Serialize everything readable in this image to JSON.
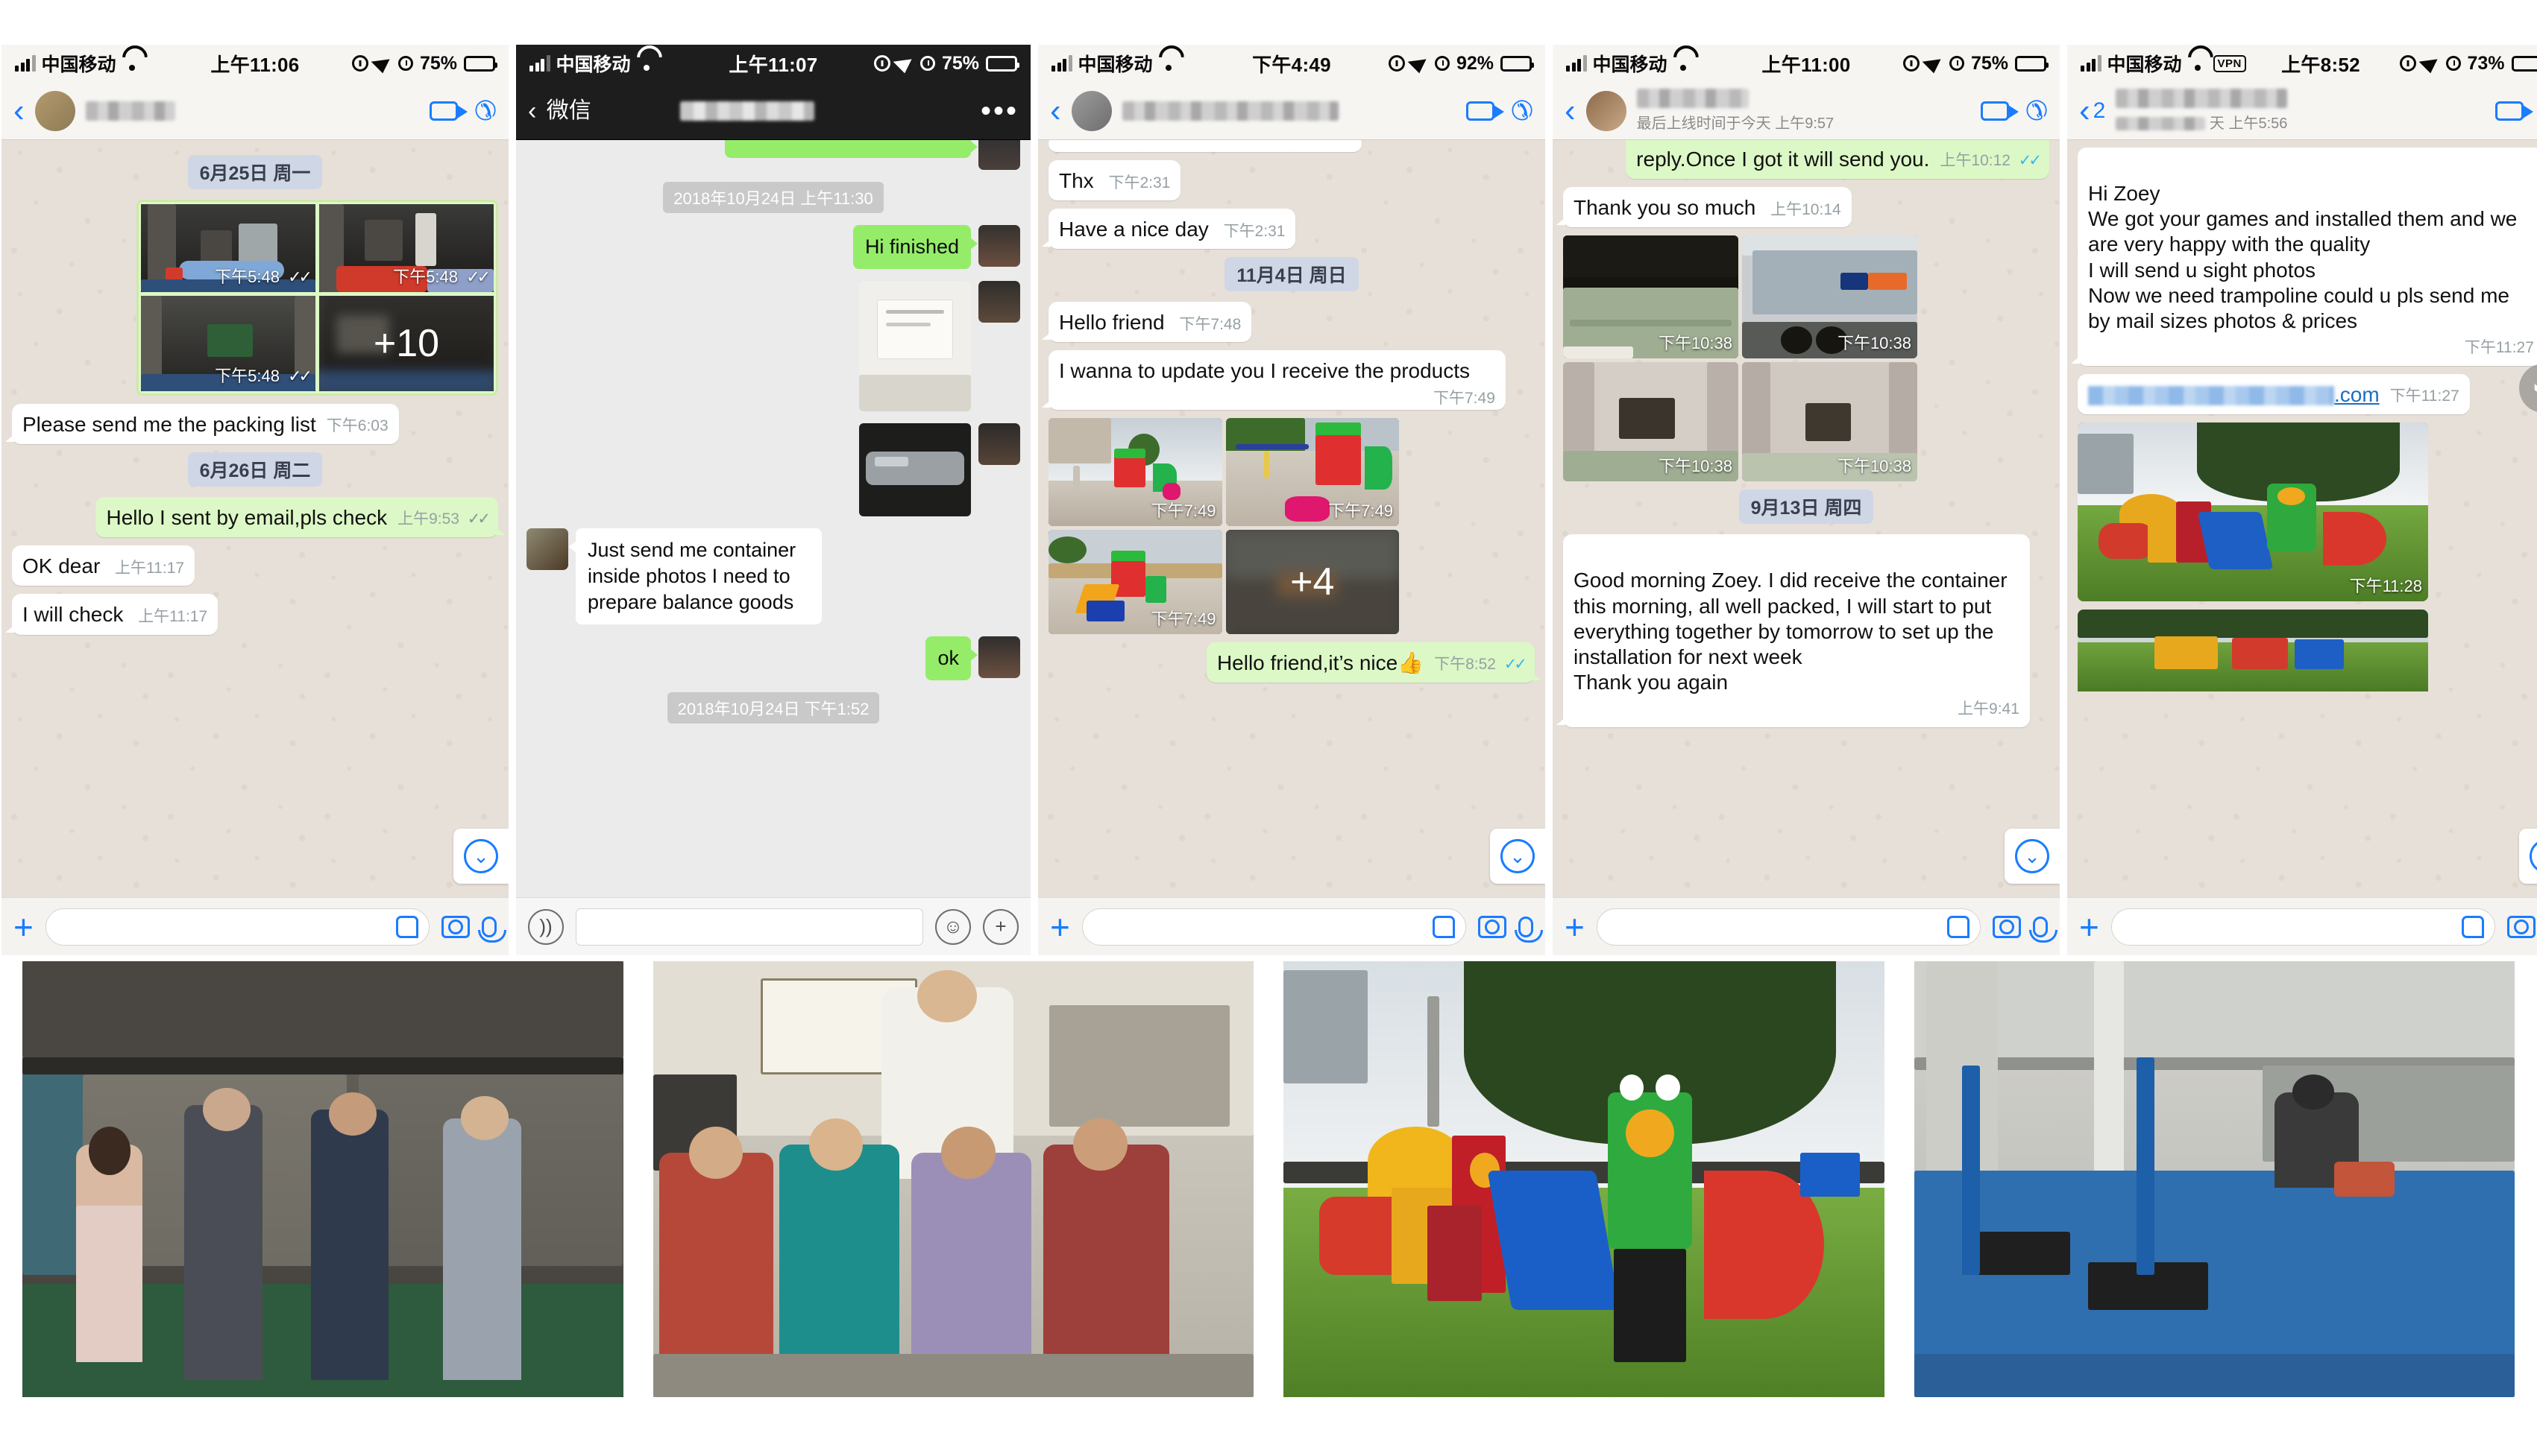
{
  "panels": [
    {
      "app": "whatsapp",
      "status": {
        "carrier": "中国移动",
        "time": "上午11:06",
        "battery": "75%",
        "icons": [
          "signal-icon",
          "wifi-icon",
          "rotation-lock-icon",
          "location-arrow-icon",
          "alarm-icon",
          "battery-icon"
        ]
      },
      "header": {
        "name_blurred": true,
        "subtitle": "",
        "back": ""
      },
      "messages": [
        {
          "type": "date",
          "text": "6月25日 周一"
        },
        {
          "type": "album",
          "side": "out",
          "count_overlay": "+10",
          "photos": [
            {
              "caption": "下午5:48",
              "ticks": "✓✓",
              "subject": "container-loading-photo"
            },
            {
              "caption": "下午5:48",
              "ticks": "✓✓",
              "subject": "container-inflatable-photo"
            },
            {
              "caption": "下午5:48",
              "ticks": "✓✓",
              "subject": "container-workers-photo"
            },
            {
              "caption": "",
              "ticks": "",
              "subject": "container-more-photo"
            }
          ]
        },
        {
          "type": "text",
          "side": "in",
          "text": "Please send me the packing list",
          "time": "下午6:03"
        },
        {
          "type": "date",
          "text": "6月26日 周二"
        },
        {
          "type": "text",
          "side": "out",
          "text": "Hello I sent by email,pls check",
          "time": "上午9:53",
          "ticks": "✓✓"
        },
        {
          "type": "text",
          "side": "in",
          "text": "OK dear",
          "time": "上午11:17"
        },
        {
          "type": "text",
          "side": "in",
          "text": "I will check",
          "time": "上午11:17"
        }
      ],
      "input": {
        "placeholder": "",
        "icons": [
          "plus-icon",
          "sticker-icon",
          "camera-icon",
          "microphone-icon"
        ]
      }
    },
    {
      "app": "wechat",
      "status": {
        "carrier": "中国移动",
        "time": "上午11:07",
        "battery": "75%",
        "icons": [
          "signal-icon",
          "wifi-icon",
          "rotation-lock-icon",
          "location-arrow-icon",
          "alarm-icon",
          "battery-icon"
        ]
      },
      "header": {
        "back_label": "微信",
        "name_blurred": true,
        "menu": "•••"
      },
      "messages": [
        {
          "type": "text",
          "side": "out",
          "text": "",
          "clipped": true
        },
        {
          "type": "time",
          "text": "2018年10月24日 上午11:30"
        },
        {
          "type": "text",
          "side": "out",
          "text": "Hi finished"
        },
        {
          "type": "image",
          "side": "out",
          "subject": "packing-label-photo"
        },
        {
          "type": "image",
          "side": "out",
          "subject": "wrapped-goods-photo"
        },
        {
          "type": "text",
          "side": "in",
          "text": "Just send me container inside photos I need to prepare balance goods"
        },
        {
          "type": "text",
          "side": "out",
          "text": "ok"
        },
        {
          "type": "time",
          "text": "2018年10月24日 下午1:52"
        }
      ],
      "input": {
        "placeholder": "",
        "icons": [
          "voice-icon",
          "emoji-icon",
          "plus-circle-icon"
        ]
      }
    },
    {
      "app": "whatsapp",
      "status": {
        "carrier": "中国移动",
        "time": "下午4:49",
        "battery": "92%",
        "icons": [
          "signal-icon",
          "wifi-icon",
          "rotation-lock-icon",
          "location-arrow-icon",
          "alarm-icon",
          "battery-icon"
        ]
      },
      "header": {
        "name_blurred": true,
        "subtitle": ""
      },
      "messages": [
        {
          "type": "text",
          "side": "in",
          "text": "Thx",
          "time": "下午2:31"
        },
        {
          "type": "text",
          "side": "in",
          "text": "Have a nice day",
          "time": "下午2:31"
        },
        {
          "type": "date",
          "text": "11月4日 周日"
        },
        {
          "type": "text",
          "side": "in",
          "text": "Hello friend",
          "time": "下午7:48"
        },
        {
          "type": "text",
          "side": "in",
          "text": "I wanna to update you I receive the products",
          "time": "下午7:49"
        },
        {
          "type": "album",
          "side": "in",
          "count_overlay": "+4",
          "photos": [
            {
              "caption": "下午7:49",
              "subject": "playground-swing-photo"
            },
            {
              "caption": "下午7:49",
              "subject": "playground-red-tower-photo"
            },
            {
              "caption": "下午7:49",
              "subject": "playground-blue-slide-photo"
            },
            {
              "caption": "",
              "subject": "playground-more-photo"
            }
          ]
        },
        {
          "type": "text",
          "side": "out",
          "text": "Hello friend,it’s  nice",
          "emoji": "👍",
          "time": "下午8:52",
          "ticks": "✓✓"
        }
      ],
      "input": {
        "placeholder": "",
        "icons": [
          "plus-icon",
          "sticker-icon",
          "camera-icon",
          "microphone-icon"
        ]
      }
    },
    {
      "app": "whatsapp",
      "status": {
        "carrier": "中国移动",
        "time": "上午11:00",
        "battery": "75%",
        "icons": [
          "signal-icon",
          "wifi-icon",
          "rotation-lock-icon",
          "location-arrow-icon",
          "alarm-icon",
          "battery-icon"
        ]
      },
      "header": {
        "name_blurred": true,
        "subtitle": "最后上线时间于今天 上午9:57"
      },
      "messages": [
        {
          "type": "text",
          "side": "out",
          "text": "reply.Once I got it will send you.",
          "time": "上午10:12",
          "ticks": "✓✓",
          "clipped": true
        },
        {
          "type": "text",
          "side": "in",
          "text": "Thank you so much",
          "time": "上午10:14"
        },
        {
          "type": "album",
          "side": "in",
          "photos": [
            {
              "caption": "下午10:38",
              "subject": "container-bales-photo"
            },
            {
              "caption": "下午10:38",
              "subject": "po-nedlloyd-truck-photo"
            },
            {
              "caption": "下午10:38",
              "subject": "container-interior-a-photo"
            },
            {
              "caption": "下午10:38",
              "subject": "container-interior-b-photo"
            }
          ]
        },
        {
          "type": "date",
          "text": "9月13日 周四"
        },
        {
          "type": "text",
          "side": "in",
          "text": "Good morning Zoey. I did receive the container this morning, all well packed, I will start to put everything together by tomorrow to set up the installation for next week\nThank you again",
          "time": "上午9:41"
        }
      ],
      "input": {
        "placeholder": "",
        "icons": [
          "plus-icon",
          "sticker-icon",
          "camera-icon",
          "microphone-icon"
        ]
      }
    },
    {
      "app": "whatsapp",
      "status": {
        "carrier": "中国移动",
        "time": "上午8:52",
        "battery": "73%",
        "battery_low": true,
        "charging": true,
        "vpn": "VPN",
        "icons": [
          "signal-icon",
          "wifi-icon",
          "vpn-icon",
          "rotation-lock-icon",
          "location-arrow-icon",
          "alarm-icon",
          "battery-icon",
          "charging-bolt-icon"
        ]
      },
      "header": {
        "back_badge": "2",
        "name_blurred": true,
        "subtitle": "天 上午5:56"
      },
      "messages": [
        {
          "type": "text",
          "side": "in",
          "text": "Hi Zoey\nWe got your games and installed them and we are very happy with the quality\nI will send u sight photos\nNow we need trampoline could u pls send me by mail sizes photos & prices",
          "time": "下午11:27"
        },
        {
          "type": "link",
          "side": "in",
          "text": ".com",
          "blurred": true,
          "time": "下午11:27"
        },
        {
          "type": "image",
          "side": "in",
          "caption": "下午11:28",
          "subject": "playground-frog-slide-photo"
        },
        {
          "type": "image",
          "side": "in",
          "caption": "",
          "subject": "playground-bottom-photo"
        }
      ],
      "input": {
        "placeholder": "",
        "icons": [
          "plus-icon",
          "sticker-icon",
          "camera-icon",
          "microphone-icon"
        ]
      }
    }
  ],
  "gallery": [
    {
      "name": "team-visit-showroom-photo",
      "alt": "Four people standing in a showroom"
    },
    {
      "name": "office-group-photo",
      "alt": "Group of men seated in an office"
    },
    {
      "name": "playground-installed-photo",
      "alt": "Colourful playground with slides under a tree"
    },
    {
      "name": "rubber-flooring-install-photo",
      "alt": "Worker installing blue rubber floor tiles"
    }
  ],
  "colors": {
    "whatsapp_out_bubble": "#dcf8c6",
    "whatsapp_in_bubble": "#ffffff",
    "whatsapp_bg": "#e7e0d8",
    "wechat_out_bubble": "#95ec69",
    "wechat_bg": "#ebebeb",
    "accent_blue": "#1a7cff",
    "tick_blue": "#34b7f1",
    "date_pill": "#cfd6e6",
    "battery_low": "#ffc600"
  }
}
